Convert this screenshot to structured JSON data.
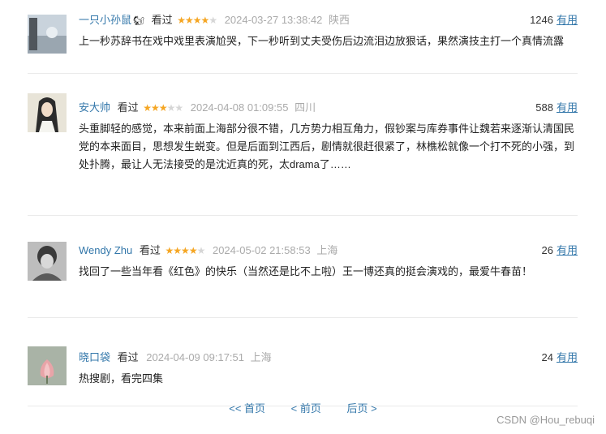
{
  "comments": [
    {
      "user": "一只小孙鼠",
      "badge": "🐿",
      "status": "看过",
      "rating": 4,
      "time": "2024-03-27 13:38:42",
      "location": "陕西",
      "votes": "1246",
      "useful_label": "有用",
      "text": "上一秒苏辞书在戏中戏里表演尬哭，下一秒听到丈夫受伤后边流泪边放狠话，果然演技主打一个真情流露"
    },
    {
      "user": "安大帅",
      "status": "看过",
      "rating": 3,
      "time": "2024-04-08 01:09:55",
      "location": "四川",
      "votes": "588",
      "useful_label": "有用",
      "text": "头重脚轻的感觉，本来前面上海部分很不错，几方势力相互角力，假钞案与库券事件让魏若来逐渐认清国民党的本来面目，思想发生蜕变。但是后面到江西后，剧情就很赶很紧了，林樵松就像一个打不死的小强，到处扑腾，最让人无法接受的是沈近真的死，太drama了……"
    },
    {
      "user": "Wendy Zhu",
      "status": "看过",
      "rating": 4,
      "time": "2024-05-02 21:58:53",
      "location": "上海",
      "votes": "26",
      "useful_label": "有用",
      "text": "找回了一些当年看《红色》的快乐（当然还是比不上啦）王一博还真的挺会演戏的，最爱牛春苗！"
    },
    {
      "user": "晓口袋",
      "status": "看过",
      "rating": 0,
      "time": "2024-04-09 09:17:51",
      "location": "上海",
      "votes": "24",
      "useful_label": "有用",
      "text": "热搜剧，看完四集"
    }
  ],
  "pager": {
    "first": "<< 首页",
    "prev": "< 前页",
    "next": "后页 >"
  },
  "watermark": "CSDN @Hou_rebuqi",
  "colors": {
    "link": "#3377aa",
    "star": "#f5a623",
    "muted": "#aaaaaa"
  }
}
